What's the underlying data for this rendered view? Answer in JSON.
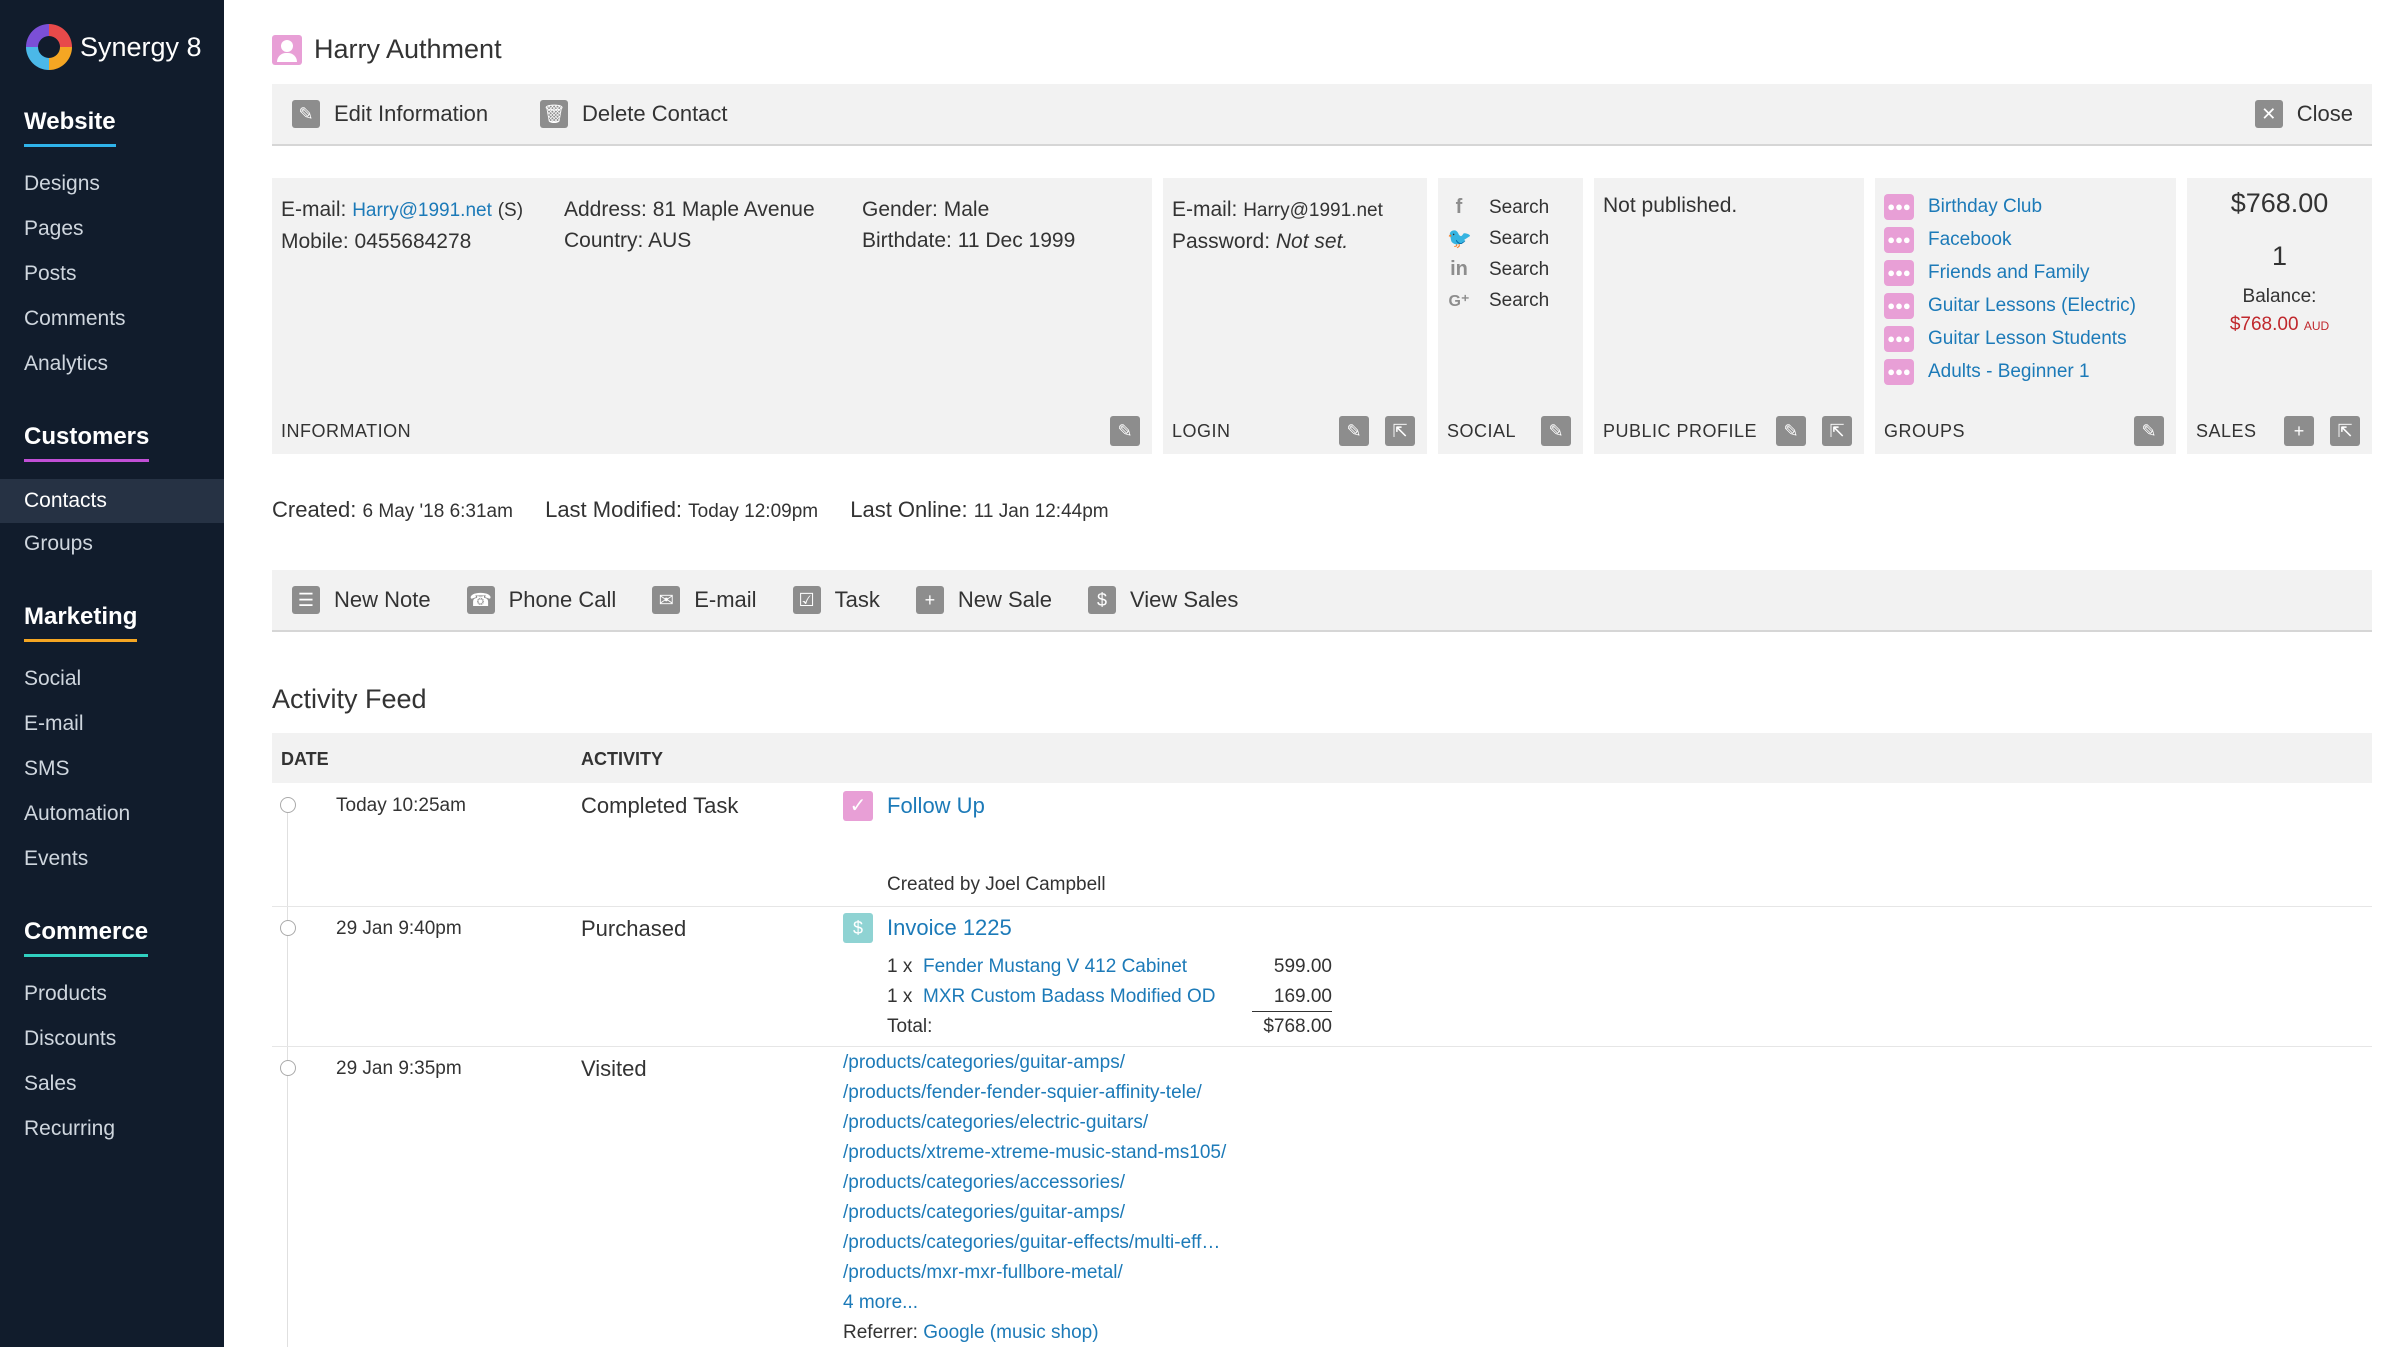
{
  "app": {
    "name": "Synergy 8"
  },
  "sidebar": {
    "sections": [
      {
        "title": "Website",
        "items": [
          "Designs",
          "Pages",
          "Posts",
          "Comments",
          "Analytics"
        ]
      },
      {
        "title": "Customers",
        "items": [
          "Contacts",
          "Groups"
        ]
      },
      {
        "title": "Marketing",
        "items": [
          "Social",
          "E-mail",
          "SMS",
          "Automation",
          "Events"
        ]
      },
      {
        "title": "Commerce",
        "items": [
          "Products",
          "Discounts",
          "Sales",
          "Recurring"
        ]
      }
    ],
    "active": "Contacts"
  },
  "contact": {
    "name": "Harry Authment",
    "toolbar": {
      "edit": "Edit Information",
      "delete": "Delete Contact",
      "close": "Close"
    },
    "information": {
      "label": "INFORMATION",
      "email_label": "E-mail:",
      "email": "Harry@1991.net",
      "email_suffix": "(S)",
      "mobile_label": "Mobile:",
      "mobile": "0455684278",
      "address_label": "Address:",
      "address": "81 Maple Avenue",
      "country_label": "Country:",
      "country": "AUS",
      "gender_label": "Gender:",
      "gender": "Male",
      "birthdate_label": "Birthdate:",
      "birthdate": "11 Dec 1999"
    },
    "login": {
      "label": "LOGIN",
      "email_label": "E-mail:",
      "email": "Harry@1991.net",
      "password_label": "Password:",
      "password": "Not set."
    },
    "social": {
      "label": "SOCIAL",
      "items": [
        "Search",
        "Search",
        "Search",
        "Search"
      ]
    },
    "public_profile": {
      "label": "PUBLIC PROFILE",
      "status": "Not published."
    },
    "groups": {
      "label": "GROUPS",
      "items": [
        "Birthday Club",
        "Facebook",
        "Friends and Family",
        "Guitar Lessons (Electric)",
        "Guitar Lesson Students",
        "Adults - Beginner 1"
      ]
    },
    "sales": {
      "label": "SALES",
      "total": "$768.00",
      "count": "1",
      "balance_label": "Balance:",
      "balance": "$768.00",
      "currency": "AUD"
    },
    "meta": {
      "created_label": "Created:",
      "created": "6 May '18 6:31am",
      "modified_label": "Last Modified:",
      "modified": "Today 12:09pm",
      "online_label": "Last Online:",
      "online": "11 Jan 12:44pm"
    },
    "actions": [
      "New Note",
      "Phone Call",
      "E-mail",
      "Task",
      "New Sale",
      "View Sales"
    ]
  },
  "feed": {
    "title": "Activity Feed",
    "columns": [
      "DATE",
      "ACTIVITY"
    ],
    "rows": [
      {
        "date": "Today 10:25am",
        "type": "Completed Task",
        "title": "Follow Up",
        "note": "Created by Joel Campbell"
      },
      {
        "date": "29 Jan 9:40pm",
        "type": "Purchased",
        "title": "Invoice 1225",
        "lines": [
          {
            "qty": "1 x",
            "item": "Fender Mustang V 412 Cabinet",
            "price": "599.00"
          },
          {
            "qty": "1 x",
            "item": "MXR Custom Badass Modified OD",
            "price": "169.00"
          }
        ],
        "total_label": "Total:",
        "total": "$768.00"
      },
      {
        "date": "29 Jan 9:35pm",
        "type": "Visited",
        "urls": [
          "/products/categories/guitar-amps/",
          "/products/fender-fender-squier-affinity-tele/",
          "/products/categories/electric-guitars/",
          "/products/xtreme-xtreme-music-stand-ms105/",
          "/products/categories/accessories/",
          "/products/categories/guitar-amps/",
          "/products/categories/guitar-effects/multi-eff…",
          "/products/mxr-mxr-fullbore-metal/"
        ],
        "more": "4 more...",
        "referrer_label": "Referrer:",
        "referrer": "Google (music shop)"
      }
    ]
  },
  "colors": {
    "sidebar": "#111c2c",
    "link": "#1c7ab8",
    "balance": "#c0282d",
    "group_icon": "#e89fd6"
  }
}
